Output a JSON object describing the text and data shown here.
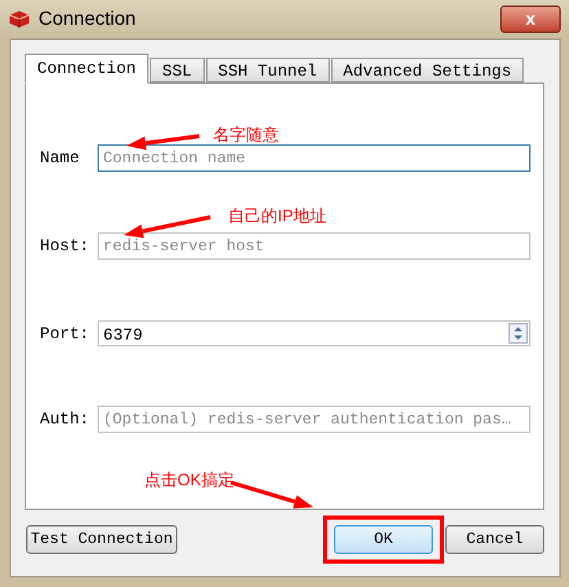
{
  "window": {
    "title": "Connection",
    "close_label": "x"
  },
  "tabs": [
    {
      "label": "Connection",
      "selected": true
    },
    {
      "label": "SSL",
      "selected": false
    },
    {
      "label": "SSH Tunnel",
      "selected": false
    },
    {
      "label": "Advanced Settings",
      "selected": false
    }
  ],
  "fields": [
    {
      "kind": "text",
      "label": "Name",
      "placeholder": "Connection name",
      "focused": true
    },
    {
      "kind": "text",
      "label": "Host:",
      "placeholder": "redis-server host",
      "focused": false
    },
    {
      "kind": "spin",
      "label": "Port:",
      "value": "6379",
      "focused": false
    },
    {
      "kind": "text",
      "label": "Auth:",
      "placeholder": "(Optional) redis-server authentication pas…",
      "focused": false
    }
  ],
  "buttons": [
    {
      "label": "Test Connection",
      "default": false,
      "highlighted": false
    },
    {
      "label": "OK",
      "default": true,
      "highlighted": true
    },
    {
      "label": "Cancel",
      "default": false,
      "highlighted": false
    }
  ],
  "annotations": [
    {
      "text": "名字随意"
    },
    {
      "text": "自己的IP地址"
    },
    {
      "text": "点击OK搞定"
    }
  ]
}
